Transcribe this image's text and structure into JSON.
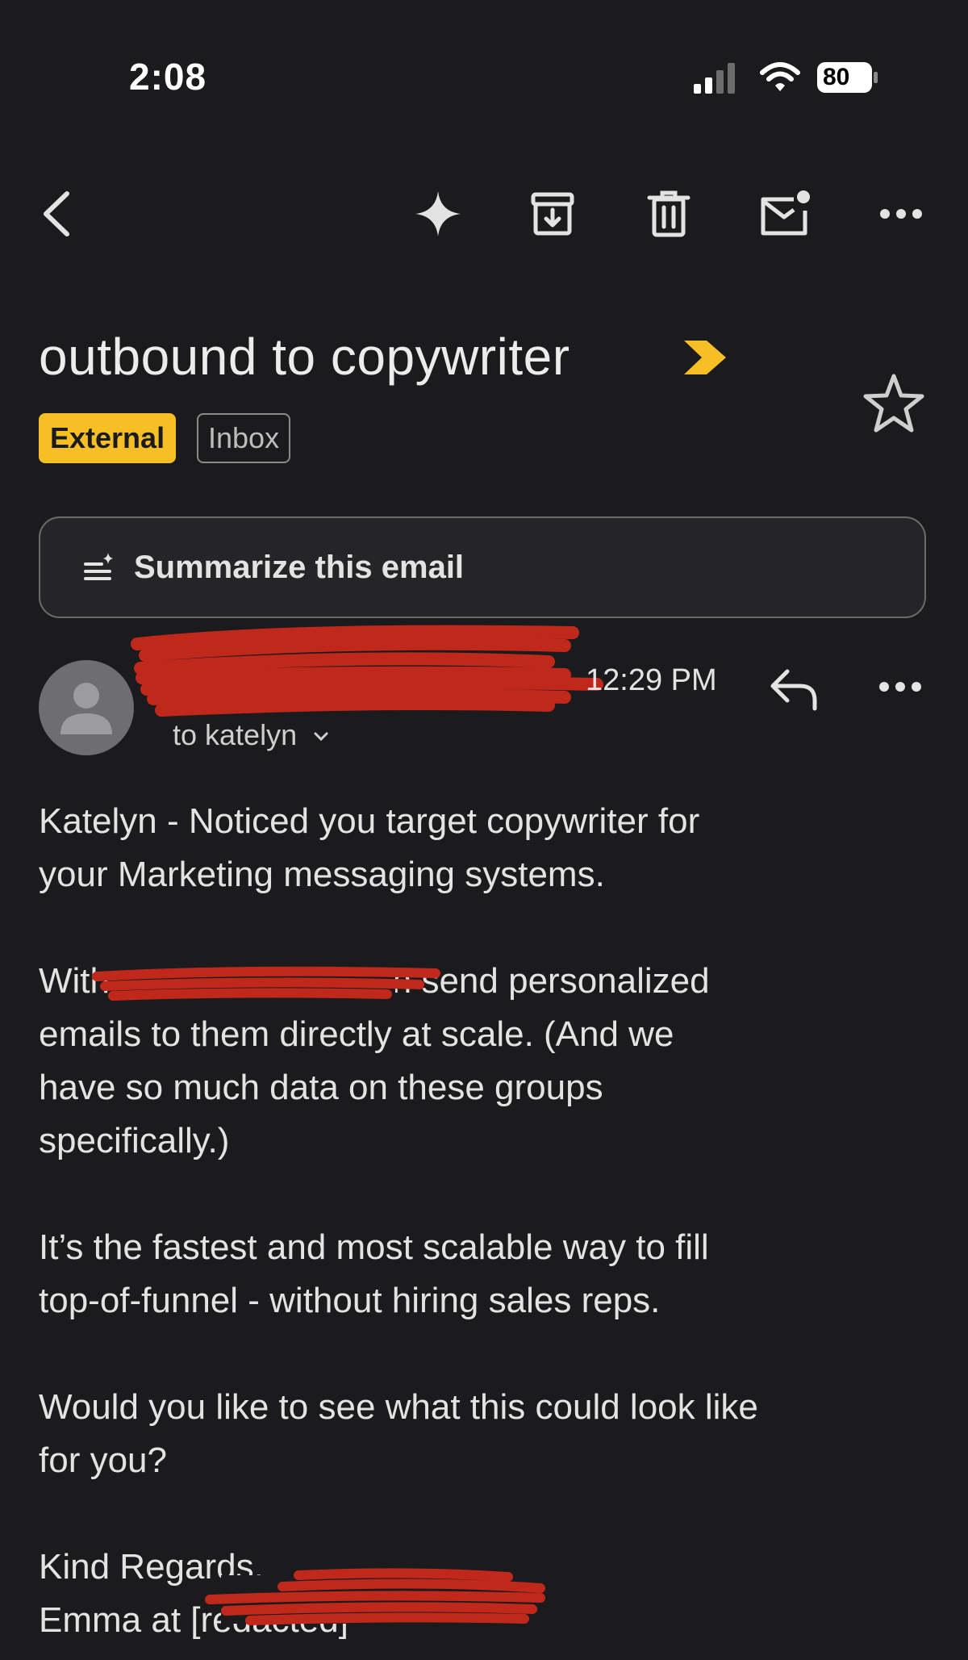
{
  "status_bar": {
    "time": "2:08",
    "battery": "80"
  },
  "toolbar": {
    "icons": [
      "back-icon",
      "sparkle-icon",
      "archive-icon",
      "trash-icon",
      "mark-unread-icon",
      "more-icon"
    ]
  },
  "email": {
    "subject": "outbound to copywriter",
    "labels": {
      "external": "External",
      "inbox": "Inbox"
    },
    "summarize_label": "Summarize this email",
    "sender": {
      "time": "12:29 PM",
      "to": "to katelyn"
    },
    "body": {
      "p1": "Katelyn - Noticed you target copywriter for\nyour Marketing messaging systems.",
      "p2": "With [redacted] you can send personalized\nemails to them directly at scale. (And we\nhave so much data on these groups\nspecifically.)",
      "p3": "It’s the fastest and most scalable way to fill\ntop-of-funnel - without hiring sales reps.",
      "p4": "Would you like to see what this could look like\nfor you?",
      "closing": "Kind Regards,",
      "signature": "Emma at [redacted]"
    }
  },
  "colors": {
    "background": "#1b1b1d",
    "external_badge": "#f6bf26",
    "importance_marker": "#f6bf26",
    "redaction": "#c0281c"
  }
}
